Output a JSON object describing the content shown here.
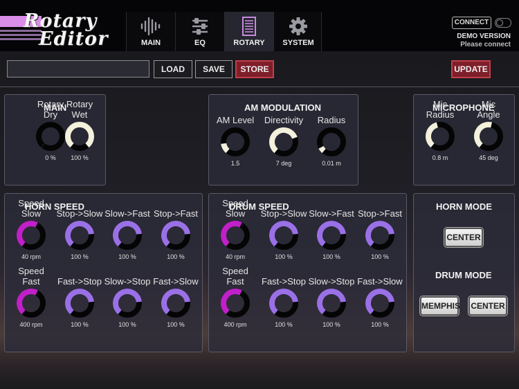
{
  "header": {
    "logo_line1": "Rotary",
    "logo_line2": "Editor",
    "tabs": [
      {
        "label": "MAIN",
        "icon": "waveform-icon"
      },
      {
        "label": "EQ",
        "icon": "sliders-icon"
      },
      {
        "label": "ROTARY",
        "icon": "rotary-speaker-icon",
        "active": true
      },
      {
        "label": "SYSTEM",
        "icon": "gear-icon"
      }
    ],
    "connect_label": "CONNECT",
    "demo_version": "DEMO VERSION",
    "please_connect": "Please connect"
  },
  "toolbar": {
    "preset_name_value": "",
    "load_label": "LOAD",
    "save_label": "SAVE",
    "store_label": "STORE",
    "update_label": "UPDATE"
  },
  "colors": {
    "accent_purple": "#9a70e6",
    "accent_magenta": "#c020c8",
    "knob_white": "#f3f0dc",
    "store_red": "#7e1f2a"
  },
  "panels": {
    "main": {
      "title": "MAIN",
      "knobs": [
        {
          "label": "Rotary\nDry",
          "value": "0 %",
          "level": 0.0,
          "color": "white"
        },
        {
          "label": "Rotary\nWet",
          "value": "100 %",
          "level": 1.0,
          "color": "white"
        }
      ]
    },
    "am": {
      "title": "AM MODULATION",
      "knobs": [
        {
          "label": "AM Level",
          "value": "1.5",
          "level": 0.15,
          "color": "white"
        },
        {
          "label": "Directivity",
          "value": "7 deg",
          "level": 0.75,
          "color": "white"
        },
        {
          "label": "Radius",
          "value": "0.01 m",
          "level": 0.08,
          "color": "white"
        }
      ]
    },
    "mic": {
      "title": "MICROPHONE",
      "knobs": [
        {
          "label": "Mic\nRadius",
          "value": "0.8 m",
          "level": 0.45,
          "color": "white"
        },
        {
          "label": "Mic\nAngle",
          "value": "45 deg",
          "level": 0.55,
          "color": "white"
        }
      ]
    },
    "horn_speed": {
      "title": "HORN SPEED",
      "knobs": [
        {
          "label": "Speed\nSlow",
          "value": "40 rpm",
          "level": 0.6,
          "color": "magenta"
        },
        {
          "label": "Stop->Slow",
          "value": "100 %",
          "level": 0.8,
          "color": "purple"
        },
        {
          "label": "Slow->Fast",
          "value": "100 %",
          "level": 0.8,
          "color": "purple"
        },
        {
          "label": "Stop->Fast",
          "value": "100 %",
          "level": 0.8,
          "color": "purple"
        },
        {
          "label": "Speed\nFast",
          "value": "400 rpm",
          "level": 0.6,
          "color": "magenta"
        },
        {
          "label": "Fast->Stop",
          "value": "100 %",
          "level": 0.8,
          "color": "purple"
        },
        {
          "label": "Slow->Stop",
          "value": "100 %",
          "level": 0.8,
          "color": "purple"
        },
        {
          "label": "Fast->Slow",
          "value": "100 %",
          "level": 0.8,
          "color": "purple"
        }
      ]
    },
    "drum_speed": {
      "title": "DRUM SPEED",
      "knobs": [
        {
          "label": "Speed\nSlow",
          "value": "40 rpm",
          "level": 0.6,
          "color": "magenta"
        },
        {
          "label": "Stop->Slow",
          "value": "100 %",
          "level": 0.8,
          "color": "purple"
        },
        {
          "label": "Slow->Fast",
          "value": "100 %",
          "level": 0.8,
          "color": "purple"
        },
        {
          "label": "Stop->Fast",
          "value": "100 %",
          "level": 0.8,
          "color": "purple"
        },
        {
          "label": "Speed\nFast",
          "value": "400 rpm",
          "level": 0.6,
          "color": "magenta"
        },
        {
          "label": "Fast->Stop",
          "value": "100 %",
          "level": 0.8,
          "color": "purple"
        },
        {
          "label": "Slow->Stop",
          "value": "100 %",
          "level": 0.8,
          "color": "purple"
        },
        {
          "label": "Fast->Slow",
          "value": "100 %",
          "level": 0.8,
          "color": "purple"
        }
      ]
    },
    "modes": {
      "horn_title": "HORN MODE",
      "horn_button": "CENTER",
      "drum_title": "DRUM MODE",
      "drum_memphis": "MEMPHIS",
      "drum_center": "CENTER"
    }
  }
}
